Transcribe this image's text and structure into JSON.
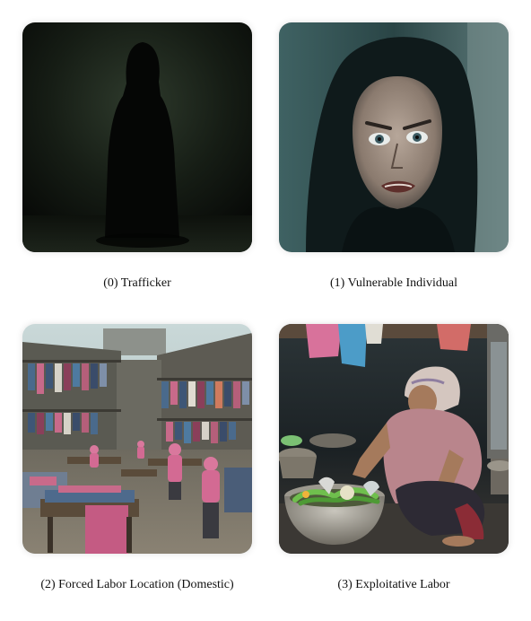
{
  "figure": {
    "panels": [
      {
        "caption": "(0) Trafficker",
        "scene": "hooded dark figure standing in a shadowy room"
      },
      {
        "caption": "(1) Vulnerable Individual",
        "scene": "frightened woman in dark headscarf"
      },
      {
        "caption": "(2) Forced Labor Location (Domestic)",
        "scene": "courtyard with clothes hanging and workers in pink"
      },
      {
        "caption": "(3) Exploitative Labor",
        "scene": "woman crouching washing vegetables in metal basin"
      }
    ]
  }
}
